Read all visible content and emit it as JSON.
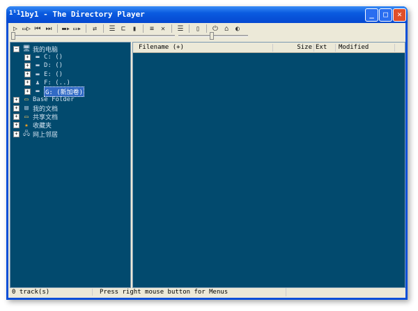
{
  "window": {
    "title": "1by1 - The Directory Player",
    "icon": "1by1-app-icon"
  },
  "toolbar": {
    "icons": [
      "play-icon",
      "play-next-icon",
      "previous-track-icon",
      "next-track-icon",
      "|",
      "folder-play-icon",
      "folder-next-icon",
      "|",
      "shuffle-icon",
      "|",
      "settings-icon",
      "window-icon",
      "bookmark-icon",
      "|",
      "equalizer-icon",
      "close-icon",
      "|",
      "list-icon",
      "|",
      "file-icon",
      "|",
      "power-icon",
      "home-icon",
      "refresh-icon"
    ]
  },
  "tree": {
    "items": [
      {
        "label": "我的电脑",
        "icon": "computer-icon",
        "pm": "−",
        "level": 0
      },
      {
        "label": "C: ()",
        "icon": "drive-icon",
        "pm": "+",
        "level": 1
      },
      {
        "label": "D: ()",
        "icon": "drive-icon",
        "pm": "+",
        "level": 1
      },
      {
        "label": "E: ()",
        "icon": "drive-icon",
        "pm": "+",
        "level": 1
      },
      {
        "label": "F: (..)",
        "icon": "network-drive-icon",
        "pm": "+",
        "level": 1
      },
      {
        "label": "G: (新加卷)",
        "icon": "drive-icon",
        "pm": "+",
        "level": 1,
        "selected": true
      },
      {
        "label": "Base Folder",
        "icon": "folder-icon",
        "pm": "+",
        "level": 0
      },
      {
        "label": "我的文档",
        "icon": "documents-icon",
        "pm": "+",
        "level": 0
      },
      {
        "label": "共享文档",
        "icon": "folder-icon",
        "pm": "+",
        "level": 0
      },
      {
        "label": "收藏夹",
        "icon": "star-icon",
        "pm": "+",
        "level": 0
      },
      {
        "label": "网上邻居",
        "icon": "network-icon",
        "pm": "+",
        "level": 0
      }
    ]
  },
  "list": {
    "columns": {
      "filename": "Filename (+)",
      "size": "Size",
      "ext": "Ext",
      "modified": "Modified"
    }
  },
  "status": {
    "tracks": "0 track(s)",
    "hint": "Press right mouse button for Menus"
  }
}
